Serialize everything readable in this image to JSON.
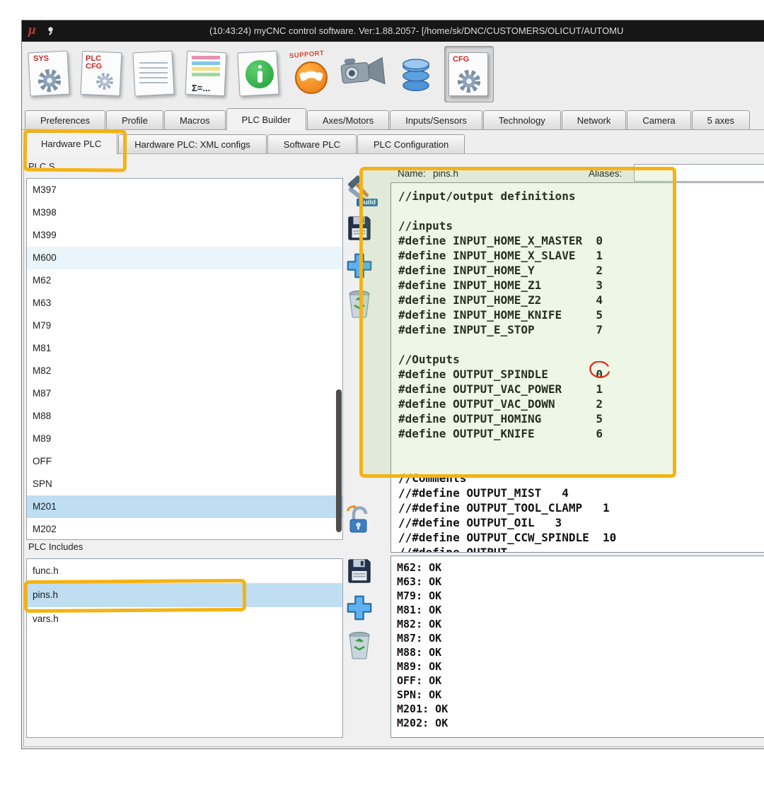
{
  "window": {
    "logo": "μ",
    "title": "(10:43:24) myCNC control software. Ver:1.88.2057- [/home/sk/DNC/CUSTOMERS/OLICUT/AUTOMU"
  },
  "toolbar": {
    "icons": [
      {
        "name": "sys-settings",
        "label": "SYS"
      },
      {
        "name": "plc-config",
        "label": "PLC\nCFG"
      },
      {
        "name": "text-editor",
        "label": ""
      },
      {
        "name": "macro-wizard",
        "label": "Σ=..."
      },
      {
        "name": "info",
        "label": ""
      },
      {
        "name": "support",
        "label": "SUPPORT"
      },
      {
        "name": "camera",
        "label": ""
      },
      {
        "name": "database",
        "label": ""
      },
      {
        "name": "cfg-settings",
        "label": "CFG"
      }
    ]
  },
  "tabs": {
    "active": "PLC Builder",
    "items": [
      "Preferences",
      "Profile",
      "Macros",
      "PLC Builder",
      "Axes/Motors",
      "Inputs/Sensors",
      "Technology",
      "Network",
      "Camera",
      "5 axes"
    ]
  },
  "subtabs": {
    "active": "Hardware PLC",
    "items": [
      "Hardware PLC",
      "Hardware PLC: XML configs",
      "Software PLC",
      "PLC Configuration"
    ]
  },
  "plc_sources": {
    "label": "PLC S",
    "selected": "M201",
    "items": [
      "M397",
      "M398",
      "M399",
      "M600",
      "M62",
      "M63",
      "M79",
      "M81",
      "M82",
      "M87",
      "M88",
      "M89",
      "OFF",
      "SPN",
      "M201",
      "M202"
    ]
  },
  "plc_includes": {
    "label": "PLC Includes",
    "selected": "pins.h",
    "items": [
      "func.h",
      "pins.h",
      "vars.h"
    ]
  },
  "side_buttons": {
    "build_label": "Build"
  },
  "editor": {
    "name_label": "Name:",
    "name_value": "pins.h",
    "aliases_label": "Aliases:",
    "aliases_value": "",
    "code_lines": [
      "//input/output definitions",
      "",
      "//inputs",
      "#define INPUT_HOME_X_MASTER  0",
      "#define INPUT_HOME_X_SLAVE   1",
      "#define INPUT_HOME_Y         2",
      "#define INPUT_HOME_Z1        3",
      "#define INPUT_HOME_Z2        4",
      "#define INPUT_HOME_KNIFE     5",
      "#define INPUT_E_STOP         7",
      "",
      "//Outputs",
      "#define OUTPUT_SPINDLE       0",
      "#define OUTPUT_VAC_POWER     1",
      "#define OUTPUT_VAC_DOWN      2",
      "#define OUTPUT_HOMING        5",
      "#define OUTPUT_KNIFE         6",
      "",
      "",
      "//Comments",
      "//#define OUTPUT_MIST   4",
      "//#define OUTPUT_TOOL_CLAMP   1",
      "//#define OUTPUT_OIL   3",
      "//#define OUTPUT_CCW_SPINDLE  10",
      "//#define OUTPUT_"
    ]
  },
  "log": {
    "lines": [
      "M62: OK",
      "M63: OK",
      "M79: OK",
      "M81: OK",
      "M82: OK",
      "M87: OK",
      "M88: OK",
      "M89: OK",
      "OFF: OK",
      "SPN: OK",
      "M201: OK",
      "M202: OK"
    ]
  },
  "colors": {
    "annotation_yellow": "#f4b313",
    "annotation_red": "#dd3322",
    "selection_blue": "#bfdef2"
  }
}
